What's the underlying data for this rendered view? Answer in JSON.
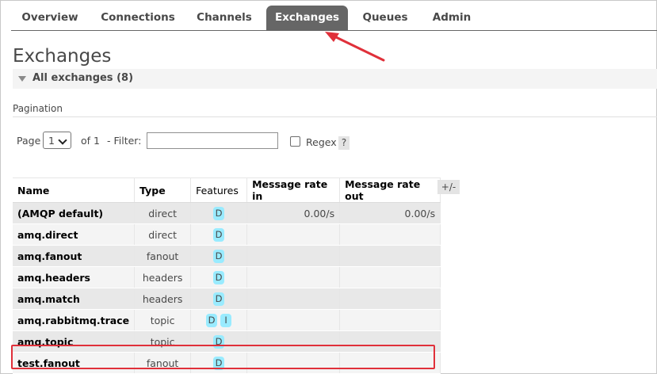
{
  "nav": {
    "tabs": [
      {
        "label": "Overview",
        "active": false
      },
      {
        "label": "Connections",
        "active": false
      },
      {
        "label": "Channels",
        "active": false
      },
      {
        "label": "Exchanges",
        "active": true
      },
      {
        "label": "Queues",
        "active": false
      },
      {
        "label": "Admin",
        "active": false
      }
    ]
  },
  "page": {
    "title": "Exchanges",
    "section_title": "All exchanges (8)"
  },
  "pagination": {
    "label": "Pagination",
    "page_label": "Page",
    "page_value": "1",
    "of_label": "of 1",
    "filter_label": "- Filter:",
    "filter_value": "",
    "regex_label": "Regex",
    "regex_checked": false,
    "help_label": "?"
  },
  "table": {
    "columns": [
      "Name",
      "Type",
      "Features",
      "Message rate in",
      "Message rate out"
    ],
    "toggle_columns_label": "+/-",
    "rows": [
      {
        "name": "(AMQP default)",
        "type": "direct",
        "features": [
          "D"
        ],
        "rate_in": "0.00/s",
        "rate_out": "0.00/s"
      },
      {
        "name": "amq.direct",
        "type": "direct",
        "features": [
          "D"
        ],
        "rate_in": "",
        "rate_out": ""
      },
      {
        "name": "amq.fanout",
        "type": "fanout",
        "features": [
          "D"
        ],
        "rate_in": "",
        "rate_out": ""
      },
      {
        "name": "amq.headers",
        "type": "headers",
        "features": [
          "D"
        ],
        "rate_in": "",
        "rate_out": ""
      },
      {
        "name": "amq.match",
        "type": "headers",
        "features": [
          "D"
        ],
        "rate_in": "",
        "rate_out": ""
      },
      {
        "name": "amq.rabbitmq.trace",
        "type": "topic",
        "features": [
          "D",
          "I"
        ],
        "rate_in": "",
        "rate_out": ""
      },
      {
        "name": "amq.topic",
        "type": "topic",
        "features": [
          "D"
        ],
        "rate_in": "",
        "rate_out": ""
      },
      {
        "name": "test.fanout",
        "type": "fanout",
        "features": [
          "D"
        ],
        "rate_in": "",
        "rate_out": ""
      }
    ]
  },
  "colors": {
    "active_tab": "#666666",
    "badge": "#99ebff",
    "annotation": "#e0303a",
    "row_alt_dark": "#e8e8e8",
    "row_alt_light": "#f4f4f4"
  }
}
